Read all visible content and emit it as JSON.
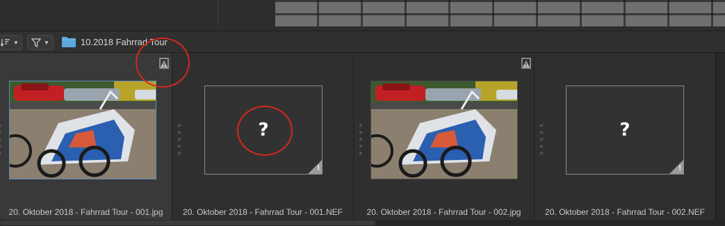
{
  "toolbar": {
    "sort_icon": "sort-descending-icon",
    "filter_icon": "filter-funnel-icon",
    "folder_icon": "folder-icon",
    "folder_color": "#5aa8dc",
    "folder_name": "10.2018 Fahrrad Tour"
  },
  "thumbnails": [
    {
      "filename": "20. Oktober 2018 - Fahrrad Tour - 001.jpg",
      "type": "photo",
      "selected": true
    },
    {
      "filename": "20. Oktober 2018 - Fahrrad Tour - 001.NEF",
      "type": "missing",
      "placeholder": "?",
      "warning": "!"
    },
    {
      "filename": "20. Oktober 2018 - Fahrrad Tour - 002.jpg",
      "type": "photo",
      "selected": false
    },
    {
      "filename": "20. Oktober 2018 - Fahrrad Tour - 002.NEF",
      "type": "missing",
      "placeholder": "?",
      "warning": "!"
    }
  ],
  "stars_glyph": "★",
  "annotation_color": "#d5281e"
}
